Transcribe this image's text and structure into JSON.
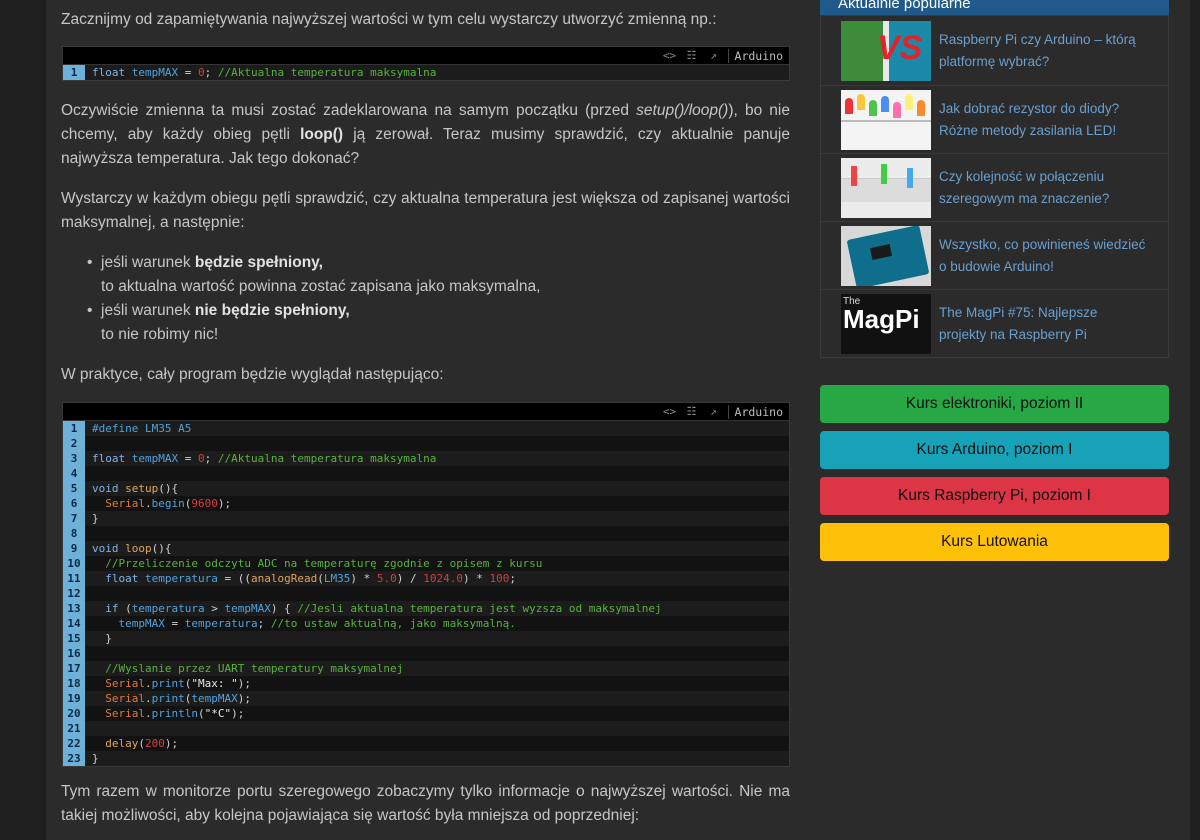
{
  "article": {
    "intro": "Zacznijmy od zapamiętywania najwyższej wartości w tym celu wystarczy utworzyć zmienną np.:",
    "para2_a": "Oczywiście zmienna ta musi zostać zadeklarowana na samym początku (przed ",
    "para2_italic": "setup()/loop()",
    "para2_b": "), bo nie chcemy, aby każdy obieg pętli ",
    "para2_bold": "loop()",
    "para2_c": " ją zerował. Teraz musimy sprawdzić, czy aktualnie panuje najwyższa temperatura. Jak tego dokonać?",
    "para3": "Wystarczy w każdym obiegu pętli sprawdzić, czy aktualna temperatura jest większa od zapisanej wartości maksymalnej, a następnie:",
    "cond1_pre": "jeśli warunek ",
    "cond1_bold": "będzie spełniony,",
    "cond1_post": "to aktualna wartość powinna zostać zapisana jako maksymalna,",
    "cond2_pre": "jeśli warunek ",
    "cond2_bold": "nie będzie spełniony,",
    "cond2_post": "to nie robimy nic!",
    "para4": "W praktyce, cały program będzie wyglądał następująco:",
    "para5": "Tym razem w monitorze portu szeregowego zobaczymy tylko informacje o najwyższej wartości. Nie ma takiej możliwości, aby kolejna pojawiająca się wartość była mniejsza od poprzedniej:"
  },
  "code_toolbar": {
    "lang": "Arduino",
    "icons": [
      "view-source-icon",
      "copy-icon",
      "expand-icon"
    ]
  },
  "snippet1": {
    "lines": [
      "float tempMAX = 0; //Aktualna temperatura maksymalna"
    ]
  },
  "snippet2": {
    "lines": [
      "#define LM35 A5",
      "",
      "float tempMAX = 0; //Aktualna temperatura maksymalna",
      "",
      "void setup(){",
      "  Serial.begin(9600);",
      "}",
      "",
      "void loop(){",
      "  //Przeliczenie odczytu ADC na temperaturę zgodnie z opisem z kursu",
      "  float temperatura = ((analogRead(LM35) * 5.0) / 1024.0) * 100;",
      "",
      "  if (temperatura > tempMAX) { //Jesli aktualna temperatura jest wyzsza od maksymalnej",
      "    tempMAX = temperatura; //to ustaw aktualną, jako maksymalną.",
      "  }",
      "",
      "  //Wyslanie przez UART temperatury maksymalnej",
      "  Serial.print(\"Max: \");",
      "  Serial.print(tempMAX);",
      "  Serial.println(\"*C\");",
      "",
      "  delay(200);",
      "}"
    ]
  },
  "sidebar": {
    "header": "Aktualnie popularne",
    "items": [
      {
        "title_l1": "Raspberry Pi czy Arduino – którą",
        "title_l2": "platformę wybrać?"
      },
      {
        "title_l1": "Jak dobrać rezystor do diody?",
        "title_l2": "Różne metody zasilania LED!"
      },
      {
        "title_l1": "Czy kolejność w połączeniu",
        "title_l2": "szeregowym ma znaczenie?"
      },
      {
        "title_l1": "Wszystko, co powinieneś wiedzieć",
        "title_l2": "o budowie Arduino!"
      },
      {
        "title_l1": "The MagPi #75: Najlepsze",
        "title_l2": "projekty na Raspberry Pi"
      }
    ],
    "thumb_magpi_label": "MagPi",
    "thumb_magpi_the": "The",
    "buttons": [
      {
        "label": "Kurs elektroniki, poziom II",
        "bg": "#28a745",
        "fg": "#111"
      },
      {
        "label": "Kurs Arduino, poziom I",
        "bg": "#17a2b8",
        "fg": "#111"
      },
      {
        "label": "Kurs Raspberry Pi, poziom I",
        "bg": "#dc3545",
        "fg": "#111"
      },
      {
        "label": "Kurs Lutowania",
        "bg": "#ffc107",
        "fg": "#111"
      }
    ]
  }
}
